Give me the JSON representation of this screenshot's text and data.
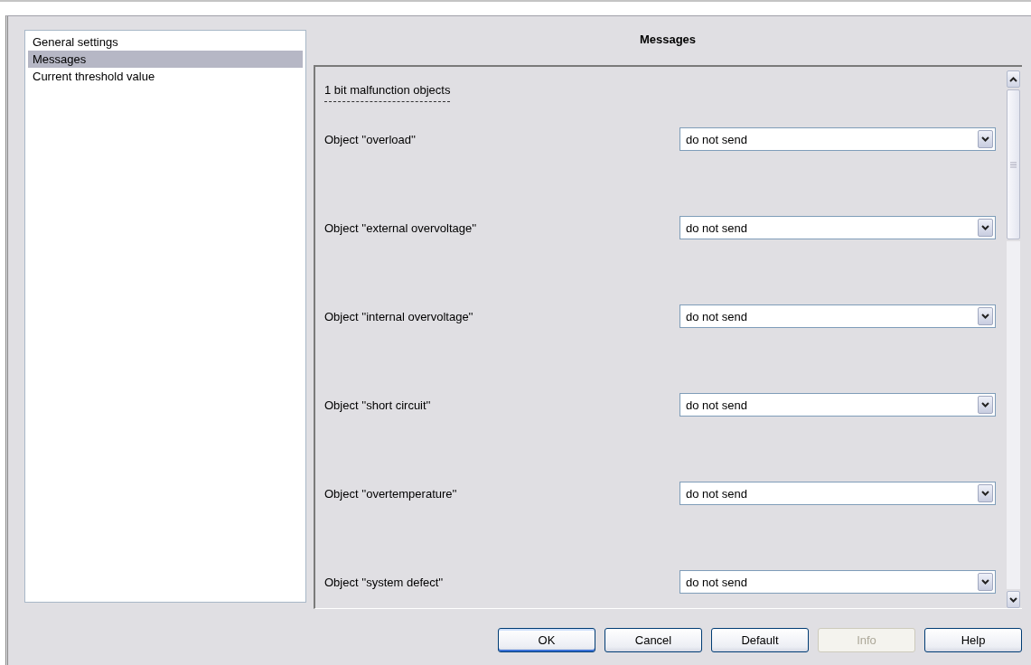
{
  "sidebar": {
    "items": [
      {
        "label": "General settings",
        "selected": false
      },
      {
        "label": "Messages",
        "selected": true
      },
      {
        "label": "Current threshold value",
        "selected": false
      }
    ]
  },
  "panel": {
    "title": "Messages",
    "section": "1 bit malfunction objects",
    "rows": [
      {
        "label": "Object ''overload''",
        "value": "do not send"
      },
      {
        "label": "Object ''external overvoltage''",
        "value": "do not send"
      },
      {
        "label": "Object ''internal overvoltage''",
        "value": "do not send"
      },
      {
        "label": "Object ''short circuit''",
        "value": "do not send"
      },
      {
        "label": "Object ''overtemperature''",
        "value": "do not send"
      },
      {
        "label": "Object ''system defect''",
        "value": "do not send"
      }
    ]
  },
  "buttons": [
    {
      "label": "OK",
      "disabled": false,
      "default": true
    },
    {
      "label": "Cancel",
      "disabled": false,
      "default": false
    },
    {
      "label": "Default",
      "disabled": false,
      "default": false
    },
    {
      "label": "Info",
      "disabled": true,
      "default": false
    },
    {
      "label": "Help",
      "disabled": false,
      "default": false
    }
  ]
}
